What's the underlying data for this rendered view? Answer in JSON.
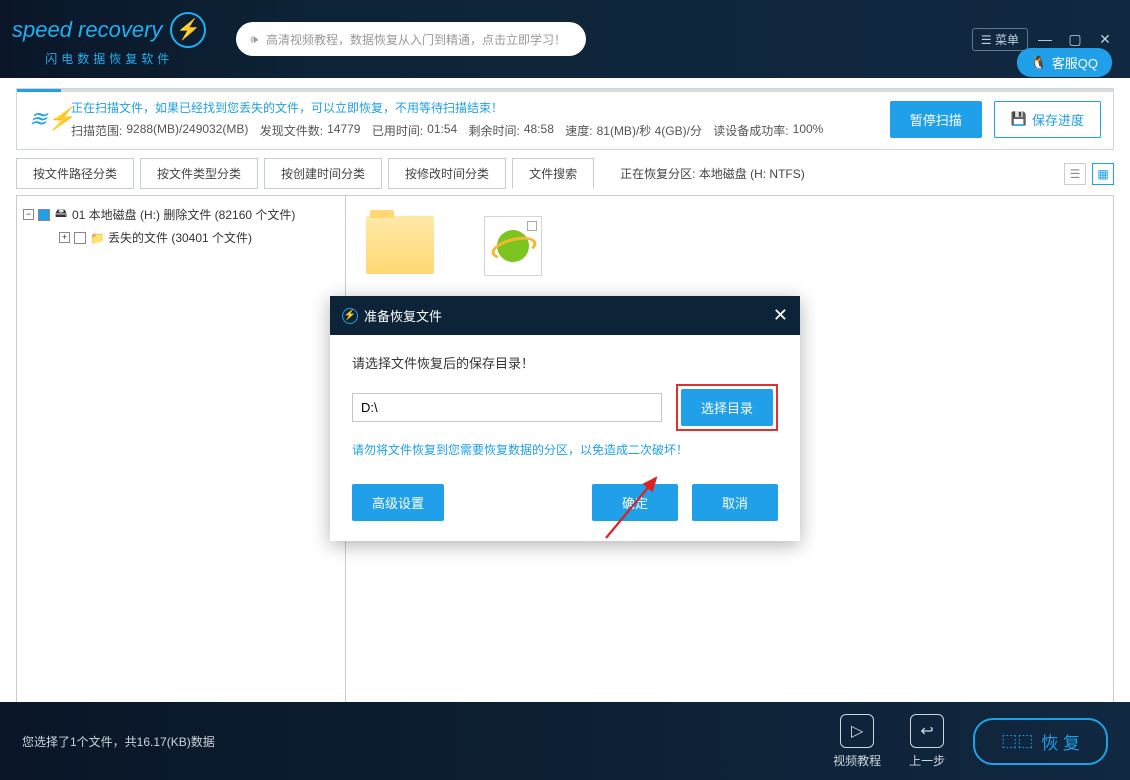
{
  "brand": {
    "name": "speed recovery",
    "sub": "闪电数据恢复软件"
  },
  "titlebar": {
    "tutorial_placeholder": "高清视频教程，数据恢复从入门到精通，点击立即学习！",
    "menu": "菜单",
    "qq": "客服QQ"
  },
  "status": {
    "msg": "正在扫描文件，如果已经找到您丢失的文件，可以立即恢复，不用等待扫描结束！",
    "range_label": "扫描范围:",
    "range": "9288(MB)/249032(MB)",
    "found_label": "发现文件数:",
    "found": "14779",
    "elapsed_label": "已用时间:",
    "elapsed": "01:54",
    "remain_label": "剩余时间:",
    "remain": "48:58",
    "speed_label": "速度:",
    "speed": "81(MB)/秒  4(GB)/分",
    "success_label": "读设备成功率:",
    "success": "100%",
    "progress_pct": 4,
    "pause": "暂停扫描",
    "save": "保存进度"
  },
  "tabs": {
    "items": [
      "按文件路径分类",
      "按文件类型分类",
      "按创建时间分类",
      "按修改时间分类",
      "文件搜索"
    ],
    "active_index": 4,
    "partition": "正在恢复分区: 本地磁盘 (H: NTFS)"
  },
  "tree": {
    "root": "01 本地磁盘 (H:) 删除文件   (82160 个文件)",
    "child": "丢失的文件   (30401 个文件)"
  },
  "footer": {
    "selection": "您选择了1个文件，共16.17(KB)数据",
    "video": "视频教程",
    "back": "上一步",
    "recover": "恢 复"
  },
  "dialog": {
    "title": "准备恢复文件",
    "label": "请选择文件恢复后的保存目录！",
    "path": "D:\\",
    "choose": "选择目录",
    "warn": "请勿将文件恢复到您需要恢复数据的分区，以免造成二次破坏！",
    "advanced": "高级设置",
    "ok": "确定",
    "cancel": "取消"
  }
}
